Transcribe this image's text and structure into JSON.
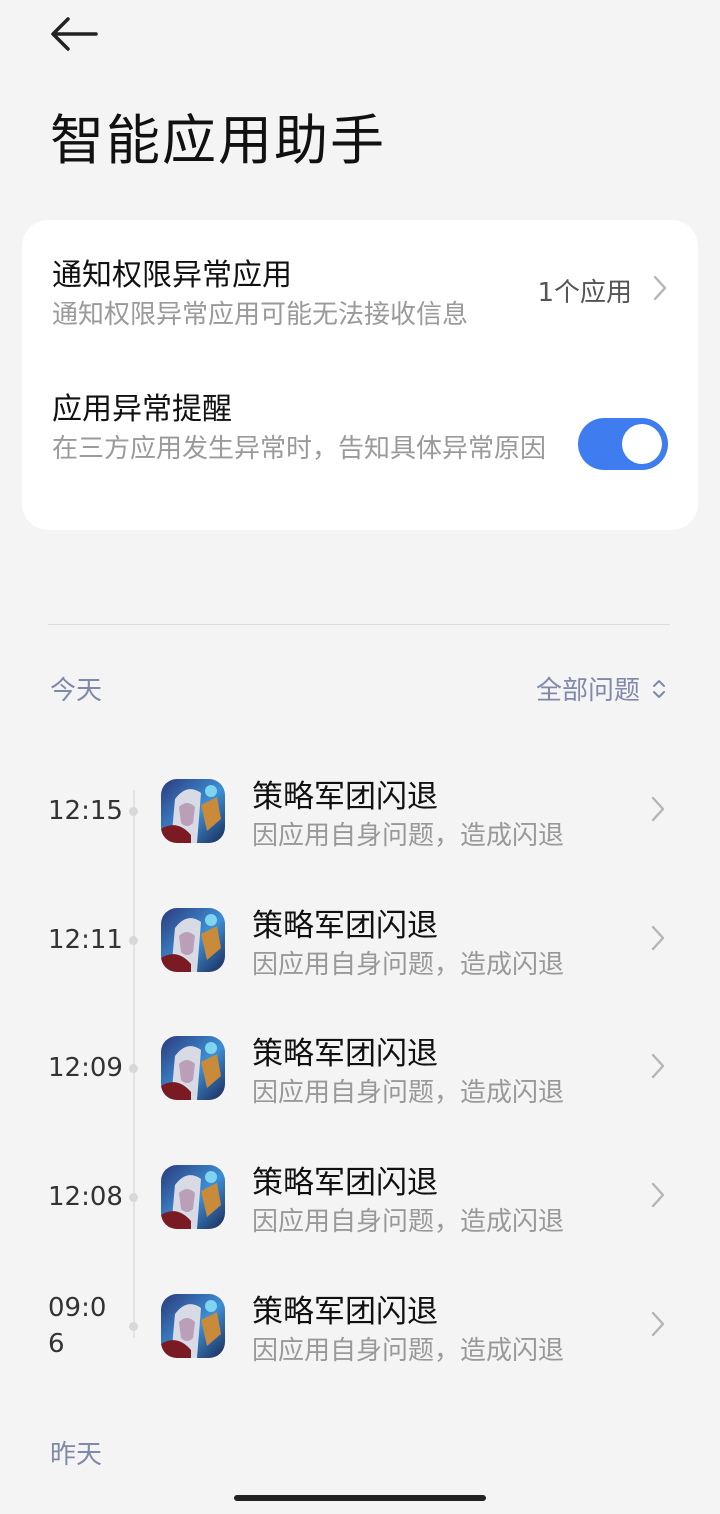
{
  "header": {
    "title": "智能应用助手"
  },
  "card": {
    "notify": {
      "title": "通知权限异常应用",
      "subtitle": "通知权限异常应用可能无法接收信息",
      "value": "1个应用"
    },
    "alert": {
      "title": "应用异常提醒",
      "subtitle": "在三方应用发生异常时，告知具体异常原因",
      "toggle_on": true
    }
  },
  "today_label": "今天",
  "filter_label": "全部问题",
  "yesterday_label": "昨天",
  "events": [
    {
      "time": "12:15",
      "name": "策略军团闪退",
      "desc": "因应用自身问题，造成闪退"
    },
    {
      "time": "12:11",
      "name": "策略军团闪退",
      "desc": "因应用自身问题，造成闪退"
    },
    {
      "time": "12:09",
      "name": "策略军团闪退",
      "desc": "因应用自身问题，造成闪退"
    },
    {
      "time": "12:08",
      "name": "策略军团闪退",
      "desc": "因应用自身问题，造成闪退"
    },
    {
      "time": "09:06",
      "time_display": "09:0\n6",
      "name": "策略军团闪退",
      "desc": "因应用自身问题，造成闪退"
    }
  ],
  "colors": {
    "accent": "#3f7cf0",
    "section_label": "#7e8aa8",
    "background": "#f4f4f4"
  }
}
